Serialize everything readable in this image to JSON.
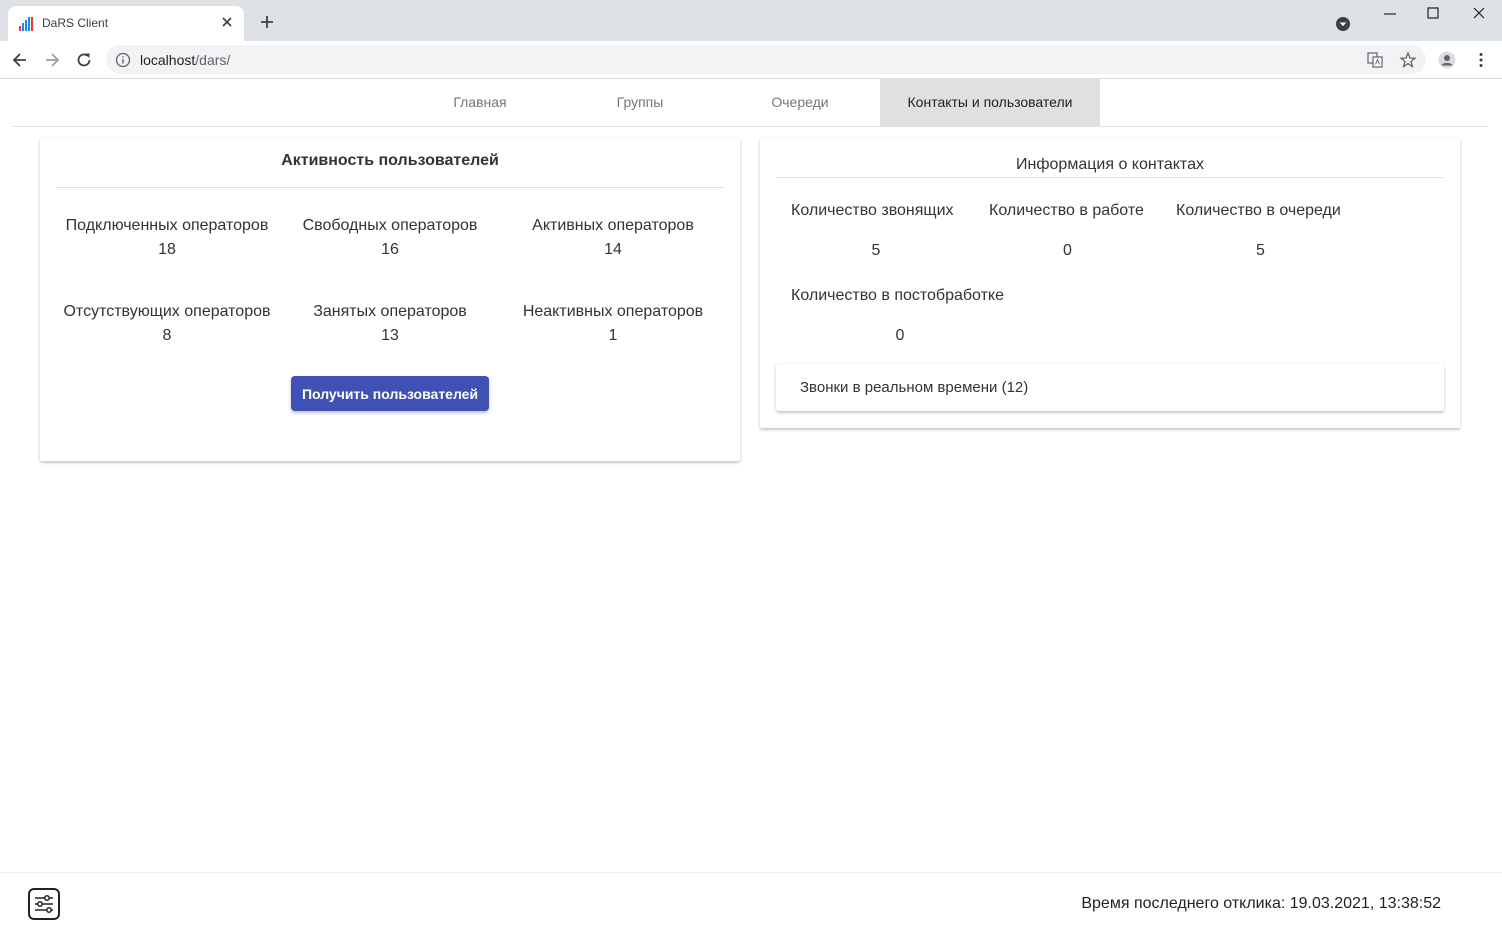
{
  "browser": {
    "tab_title": "DaRS Client",
    "url_host": "localhost",
    "url_path": "/dars/"
  },
  "nav": {
    "tabs": [
      {
        "label": "Главная"
      },
      {
        "label": "Группы"
      },
      {
        "label": "Очереди"
      },
      {
        "label": "Контакты и пользователи"
      }
    ]
  },
  "user_activity": {
    "title": "Активность пользователей",
    "stats": [
      {
        "label": "Подключенных операторов",
        "value": "18"
      },
      {
        "label": "Свободных операторов",
        "value": "16"
      },
      {
        "label": "Активных операторов",
        "value": "14"
      },
      {
        "label": "Отсутствующих операторов",
        "value": "8"
      },
      {
        "label": "Занятых операторов",
        "value": "13"
      },
      {
        "label": "Неактивных операторов",
        "value": "1"
      }
    ],
    "button_label": "Получить пользователей"
  },
  "contacts_info": {
    "title": "Информация о контактах",
    "stats": [
      {
        "label": "Количество звонящих",
        "value": "5"
      },
      {
        "label": "Количество в работе",
        "value": "0"
      },
      {
        "label": "Количество в очереди",
        "value": "5"
      },
      {
        "label": "Количество в постобработке",
        "value": "0"
      }
    ],
    "realtime_calls_label": "Звонки в реальном времени (12)"
  },
  "footer": {
    "last_response": "Время последнего отклика: 19.03.2021, 13:38:52"
  },
  "colors": {
    "accent": "#3f51b5",
    "active_tab_bg": "#e0e0e0"
  }
}
